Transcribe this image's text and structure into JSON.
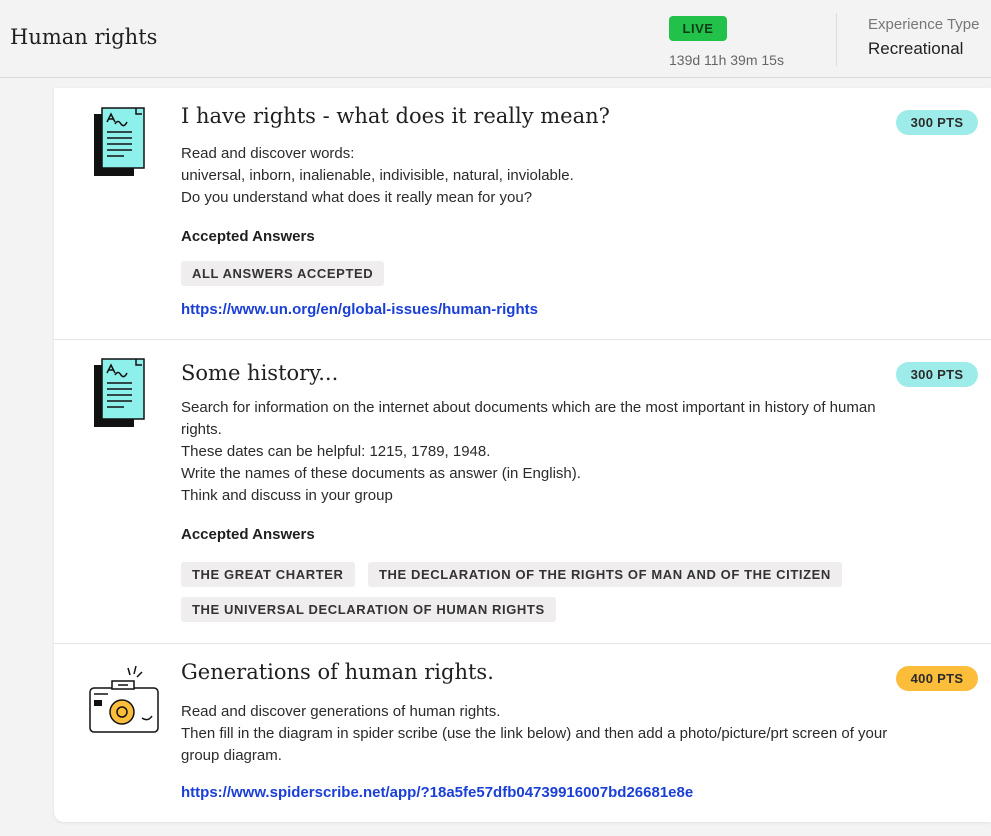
{
  "header": {
    "title": "Human rights",
    "status_badge": "LIVE",
    "countdown": "139d 11h 39m 15s",
    "experience_type_label": "Experience Type",
    "experience_type_value": "Recreational"
  },
  "colors": {
    "live": "#22c24a",
    "pts_teal": "#9eecea",
    "pts_orange": "#fbbd3a",
    "link": "#1a3fd6",
    "tag_bg": "#efedee"
  },
  "missions": [
    {
      "icon": "document-icon",
      "title": "I have rights - what does it really mean?",
      "points": "300 PTS",
      "description": [
        "Read and discover words:",
        "universal, inborn, inalienable, indivisible, natural, inviolable.",
        "Do you understand what does it really mean for you?"
      ],
      "accepted_label": "Accepted Answers",
      "answers": [
        "ALL ANSWERS ACCEPTED"
      ],
      "link": "https://www.un.org/en/global-issues/human-rights"
    },
    {
      "icon": "document-icon",
      "title": "Some history...",
      "points": "300 PTS",
      "description": [
        "Search for information on the internet about documents which are the most important in history of human",
        "rights.",
        "These dates can be helpful: 1215, 1789, 1948.",
        "Write the names of these documents as answer (in English).",
        "Think and discuss in your group"
      ],
      "accepted_label": "Accepted Answers",
      "answers": [
        "THE GREAT CHARTER",
        "THE DECLARATION OF THE RIGHTS OF MAN AND OF THE CITIZEN",
        "THE UNIVERSAL DECLARATION OF HUMAN RIGHTS"
      ]
    },
    {
      "icon": "camera-icon",
      "title": "Generations of human rights.",
      "points": "400 PTS",
      "description": [
        "Read and discover generations of human rights.",
        "Then fill in the diagram in spider scribe (use the link below) and then add a photo/picture/prt screen of your",
        "group diagram."
      ],
      "link": "https://www.spiderscribe.net/app/?18a5fe57dfb04739916007bd26681e8e"
    }
  ]
}
